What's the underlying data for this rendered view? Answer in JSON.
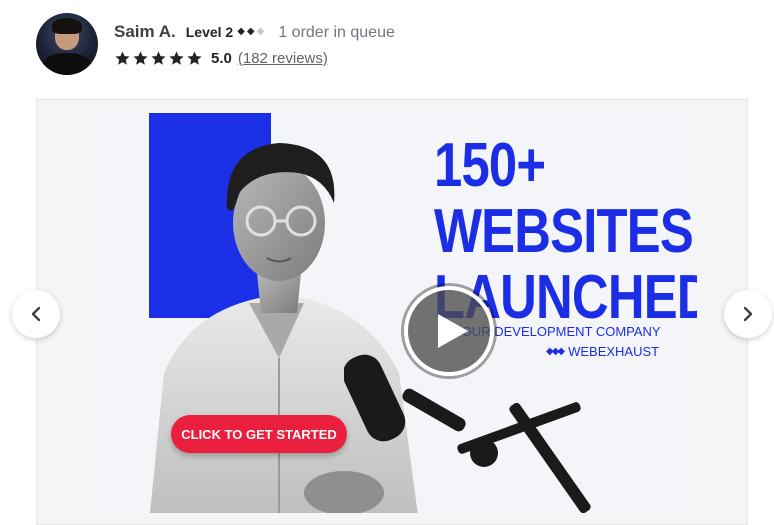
{
  "seller": {
    "name": "Saim A.",
    "level_label": "Level 2",
    "level_diamonds_filled": 2,
    "level_diamonds_total": 3,
    "queue_text": "1 order in queue",
    "rating": "5.0",
    "stars_filled": 5,
    "reviews_text": "(182 reviews)"
  },
  "gallery": {
    "headline_line1": "150+",
    "headline_line2": "WEBSITES",
    "headline_line3": "LAUNCHED",
    "subline": "BY OUR DEVELOPMENT COMPANY",
    "brand_name": "WEBEXHAUST",
    "cta_label": "CLICK TO GET STARTED",
    "play_icon": "play-icon",
    "prev_icon": "chevron-left-icon",
    "next_icon": "chevron-right-icon"
  },
  "colors": {
    "accent_blue": "#1b2ee6",
    "cta_red": "#ea1f3d",
    "text_dark": "#222325",
    "text_muted": "#74767e"
  }
}
